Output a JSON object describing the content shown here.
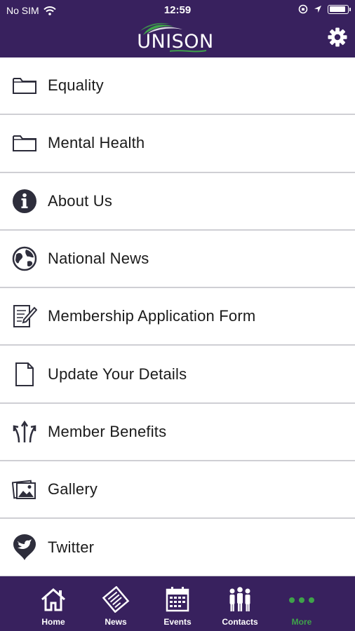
{
  "status_bar": {
    "carrier": "No SIM",
    "time": "12:59",
    "battery_level": 0.9
  },
  "header": {
    "logo_text": "UNISON",
    "settings_icon": "gear-icon",
    "colors": {
      "bar": "#38215e",
      "logo_swoosh": "#3fa24a"
    }
  },
  "menu": {
    "items": [
      {
        "label": "Equality",
        "icon": "folder-icon"
      },
      {
        "label": "Mental Health",
        "icon": "folder-icon"
      },
      {
        "label": "About Us",
        "icon": "info-icon"
      },
      {
        "label": "National News",
        "icon": "globe-icon"
      },
      {
        "label": "Membership Application Form",
        "icon": "form-edit-icon"
      },
      {
        "label": "Update Your Details",
        "icon": "document-icon"
      },
      {
        "label": "Member Benefits",
        "icon": "branch-arrows-icon"
      },
      {
        "label": "Gallery",
        "icon": "photos-icon"
      },
      {
        "label": "Twitter",
        "icon": "twitter-pin-icon"
      }
    ]
  },
  "tabbar": {
    "tabs": [
      {
        "label": "Home",
        "icon": "home-icon",
        "active": false
      },
      {
        "label": "News",
        "icon": "newspaper-icon",
        "active": false
      },
      {
        "label": "Events",
        "icon": "calendar-icon",
        "active": false
      },
      {
        "label": "Contacts",
        "icon": "people-icon",
        "active": false
      },
      {
        "label": "More",
        "icon": "more-dots-icon",
        "active": true
      }
    ],
    "colors": {
      "active": "#3fa24a",
      "inactive": "#ffffff"
    }
  }
}
